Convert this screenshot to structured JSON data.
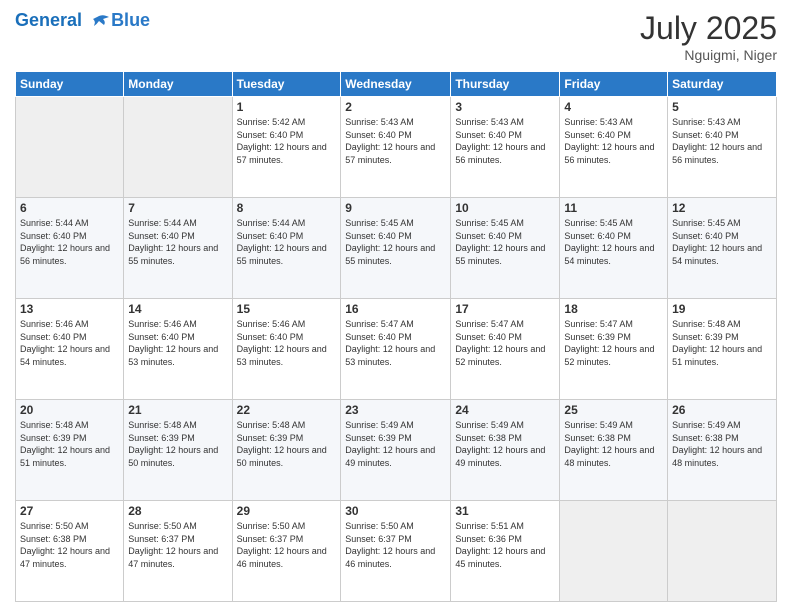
{
  "header": {
    "logo_line1": "General",
    "logo_line2": "Blue",
    "month_year": "July 2025",
    "location": "Nguigmi, Niger"
  },
  "days_of_week": [
    "Sunday",
    "Monday",
    "Tuesday",
    "Wednesday",
    "Thursday",
    "Friday",
    "Saturday"
  ],
  "weeks": [
    [
      {
        "day": "",
        "info": ""
      },
      {
        "day": "",
        "info": ""
      },
      {
        "day": "1",
        "info": "Sunrise: 5:42 AM\nSunset: 6:40 PM\nDaylight: 12 hours and 57 minutes."
      },
      {
        "day": "2",
        "info": "Sunrise: 5:43 AM\nSunset: 6:40 PM\nDaylight: 12 hours and 57 minutes."
      },
      {
        "day": "3",
        "info": "Sunrise: 5:43 AM\nSunset: 6:40 PM\nDaylight: 12 hours and 56 minutes."
      },
      {
        "day": "4",
        "info": "Sunrise: 5:43 AM\nSunset: 6:40 PM\nDaylight: 12 hours and 56 minutes."
      },
      {
        "day": "5",
        "info": "Sunrise: 5:43 AM\nSunset: 6:40 PM\nDaylight: 12 hours and 56 minutes."
      }
    ],
    [
      {
        "day": "6",
        "info": "Sunrise: 5:44 AM\nSunset: 6:40 PM\nDaylight: 12 hours and 56 minutes."
      },
      {
        "day": "7",
        "info": "Sunrise: 5:44 AM\nSunset: 6:40 PM\nDaylight: 12 hours and 55 minutes."
      },
      {
        "day": "8",
        "info": "Sunrise: 5:44 AM\nSunset: 6:40 PM\nDaylight: 12 hours and 55 minutes."
      },
      {
        "day": "9",
        "info": "Sunrise: 5:45 AM\nSunset: 6:40 PM\nDaylight: 12 hours and 55 minutes."
      },
      {
        "day": "10",
        "info": "Sunrise: 5:45 AM\nSunset: 6:40 PM\nDaylight: 12 hours and 55 minutes."
      },
      {
        "day": "11",
        "info": "Sunrise: 5:45 AM\nSunset: 6:40 PM\nDaylight: 12 hours and 54 minutes."
      },
      {
        "day": "12",
        "info": "Sunrise: 5:45 AM\nSunset: 6:40 PM\nDaylight: 12 hours and 54 minutes."
      }
    ],
    [
      {
        "day": "13",
        "info": "Sunrise: 5:46 AM\nSunset: 6:40 PM\nDaylight: 12 hours and 54 minutes."
      },
      {
        "day": "14",
        "info": "Sunrise: 5:46 AM\nSunset: 6:40 PM\nDaylight: 12 hours and 53 minutes."
      },
      {
        "day": "15",
        "info": "Sunrise: 5:46 AM\nSunset: 6:40 PM\nDaylight: 12 hours and 53 minutes."
      },
      {
        "day": "16",
        "info": "Sunrise: 5:47 AM\nSunset: 6:40 PM\nDaylight: 12 hours and 53 minutes."
      },
      {
        "day": "17",
        "info": "Sunrise: 5:47 AM\nSunset: 6:40 PM\nDaylight: 12 hours and 52 minutes."
      },
      {
        "day": "18",
        "info": "Sunrise: 5:47 AM\nSunset: 6:39 PM\nDaylight: 12 hours and 52 minutes."
      },
      {
        "day": "19",
        "info": "Sunrise: 5:48 AM\nSunset: 6:39 PM\nDaylight: 12 hours and 51 minutes."
      }
    ],
    [
      {
        "day": "20",
        "info": "Sunrise: 5:48 AM\nSunset: 6:39 PM\nDaylight: 12 hours and 51 minutes."
      },
      {
        "day": "21",
        "info": "Sunrise: 5:48 AM\nSunset: 6:39 PM\nDaylight: 12 hours and 50 minutes."
      },
      {
        "day": "22",
        "info": "Sunrise: 5:48 AM\nSunset: 6:39 PM\nDaylight: 12 hours and 50 minutes."
      },
      {
        "day": "23",
        "info": "Sunrise: 5:49 AM\nSunset: 6:39 PM\nDaylight: 12 hours and 49 minutes."
      },
      {
        "day": "24",
        "info": "Sunrise: 5:49 AM\nSunset: 6:38 PM\nDaylight: 12 hours and 49 minutes."
      },
      {
        "day": "25",
        "info": "Sunrise: 5:49 AM\nSunset: 6:38 PM\nDaylight: 12 hours and 48 minutes."
      },
      {
        "day": "26",
        "info": "Sunrise: 5:49 AM\nSunset: 6:38 PM\nDaylight: 12 hours and 48 minutes."
      }
    ],
    [
      {
        "day": "27",
        "info": "Sunrise: 5:50 AM\nSunset: 6:38 PM\nDaylight: 12 hours and 47 minutes."
      },
      {
        "day": "28",
        "info": "Sunrise: 5:50 AM\nSunset: 6:37 PM\nDaylight: 12 hours and 47 minutes."
      },
      {
        "day": "29",
        "info": "Sunrise: 5:50 AM\nSunset: 6:37 PM\nDaylight: 12 hours and 46 minutes."
      },
      {
        "day": "30",
        "info": "Sunrise: 5:50 AM\nSunset: 6:37 PM\nDaylight: 12 hours and 46 minutes."
      },
      {
        "day": "31",
        "info": "Sunrise: 5:51 AM\nSunset: 6:36 PM\nDaylight: 12 hours and 45 minutes."
      },
      {
        "day": "",
        "info": ""
      },
      {
        "day": "",
        "info": ""
      }
    ]
  ]
}
